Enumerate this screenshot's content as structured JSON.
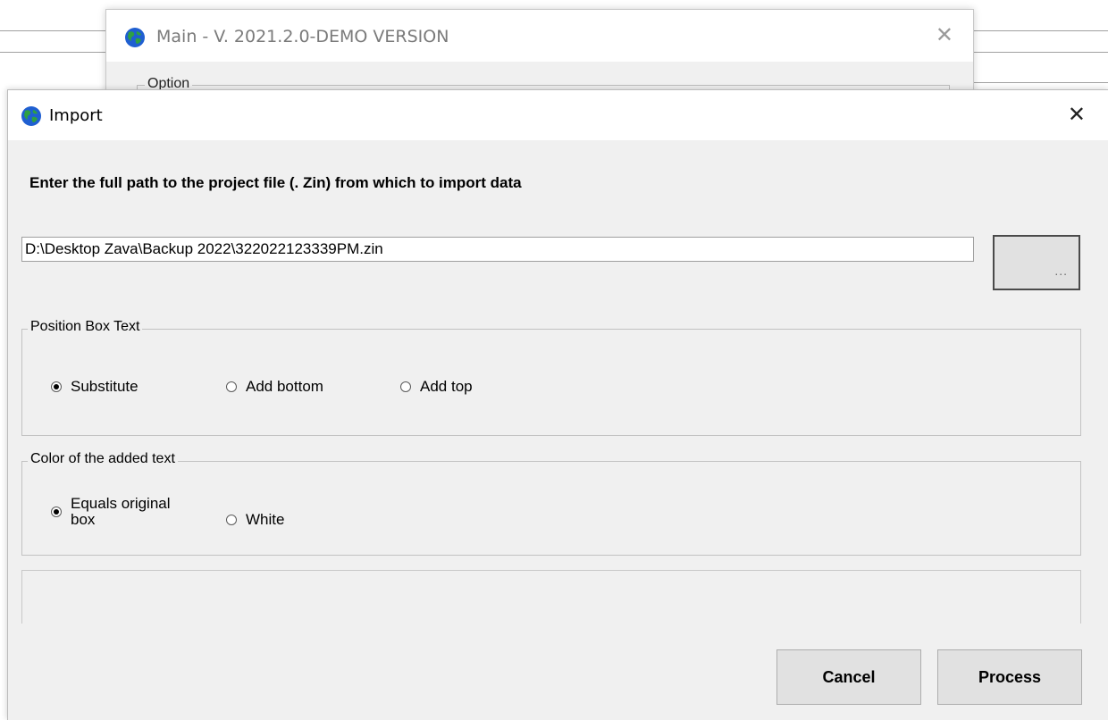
{
  "main_window": {
    "title": "Main - V. 2021.2.0-DEMO VERSION",
    "close_symbol": "✕",
    "option_label": "Option"
  },
  "import_dialog": {
    "title": "Import",
    "close_symbol": "✕",
    "instruction": "Enter the full path to the project file (. Zin) from which to import data",
    "path_value": "D:\\Desktop Zava\\Backup 2022\\322022123339PM.zin",
    "browse_label": "...",
    "position_group": {
      "label": "Position Box Text",
      "options": [
        "Substitute",
        "Add bottom",
        "Add top"
      ],
      "selected": "Substitute"
    },
    "color_group": {
      "label": "Color of the added text",
      "option_equals_line1": "Equals original",
      "option_equals_line2": "box",
      "option_white": "White",
      "selected": "Equals original box"
    },
    "buttons": {
      "cancel": "Cancel",
      "process": "Process"
    }
  },
  "icons": {
    "app": "globe-icon"
  }
}
